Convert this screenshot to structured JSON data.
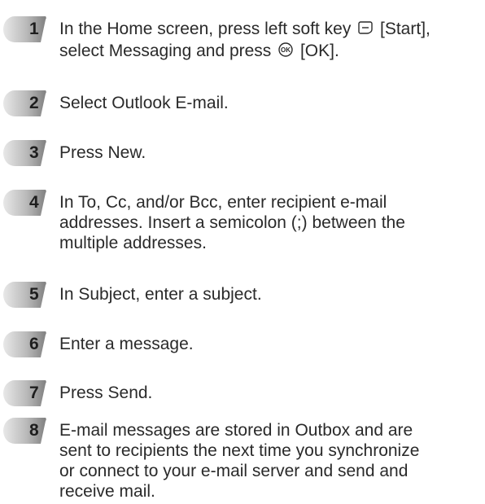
{
  "colors": {
    "badge_light": "#e6e6e6",
    "badge_dark": "#8a8a8a",
    "text": "#2a2a2a"
  },
  "steps": [
    {
      "number": "1",
      "line1_a": "In the Home screen, press left soft key ",
      "line1_icon": "left-soft-key-icon",
      "line1_b": " [Start],",
      "line2_a": "select Messaging and press ",
      "line2_icon": "ok-key-icon",
      "line2_b": " [OK]."
    },
    {
      "number": "2",
      "text": "Select Outlook E-mail."
    },
    {
      "number": "3",
      "text": "Press New."
    },
    {
      "number": "4",
      "lines": [
        "In To, Cc, and/or Bcc, enter recipient e-mail",
        "addresses. Insert a semicolon (;) between the",
        "multiple addresses."
      ]
    },
    {
      "number": "5",
      "text": "In Subject, enter a subject."
    },
    {
      "number": "6",
      "text": "Enter a message."
    },
    {
      "number": "7",
      "text": "Press Send."
    },
    {
      "number": "8",
      "lines": [
        "E-mail messages are stored in Outbox and are",
        "sent to recipients the next time you synchronize",
        "or connect to your e-mail server and send and",
        "receive mail."
      ]
    }
  ]
}
